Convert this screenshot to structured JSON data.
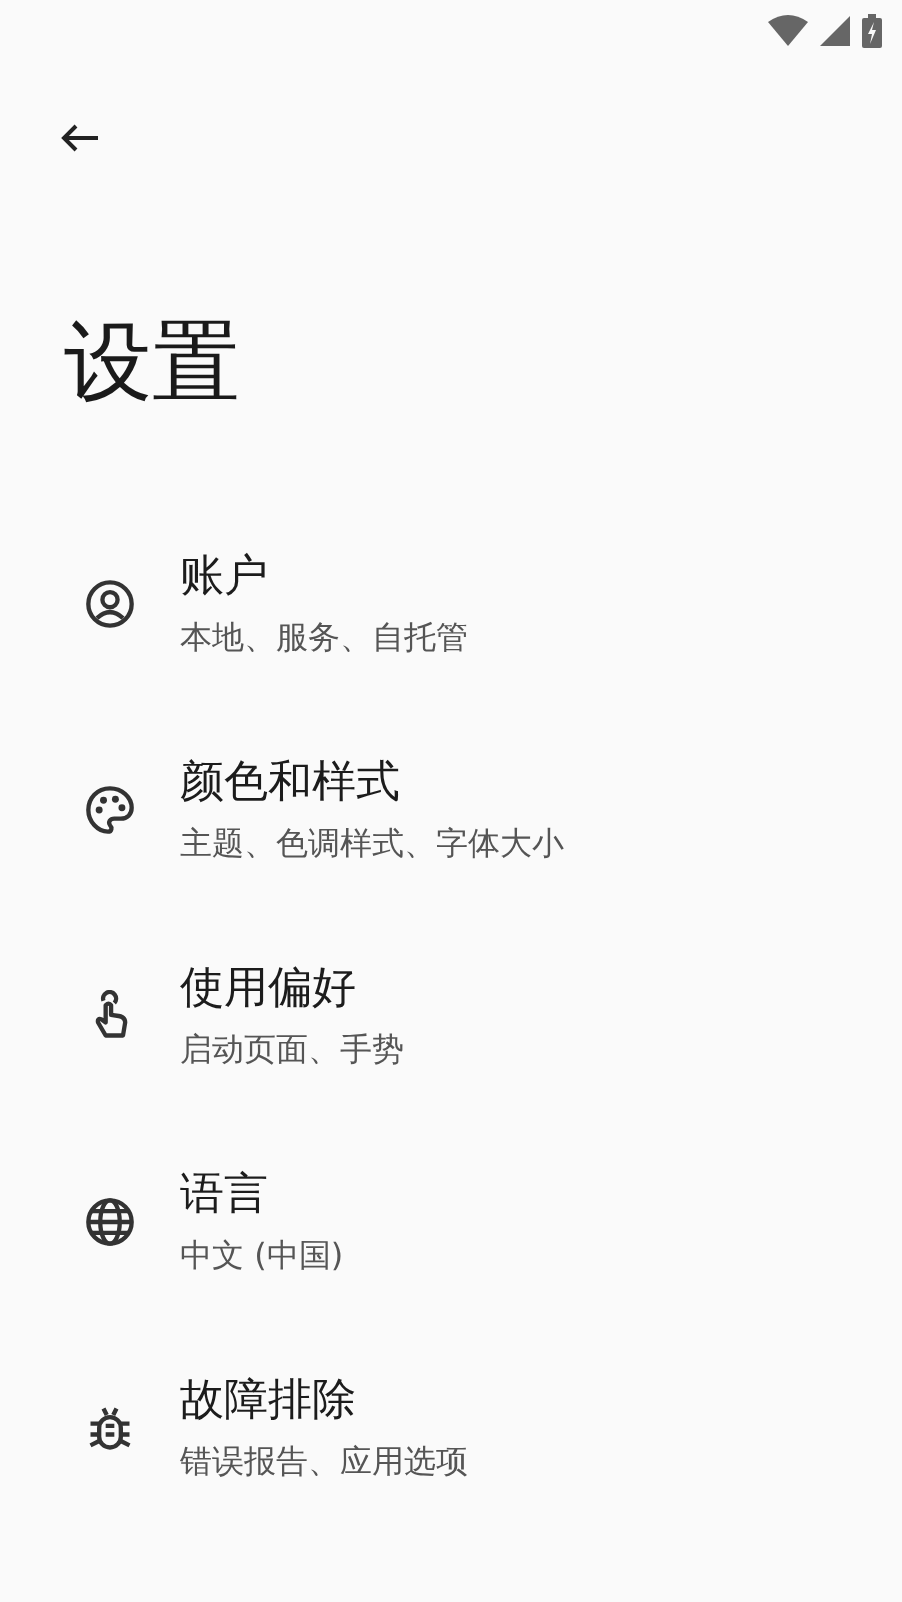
{
  "page_title": "设置",
  "items": [
    {
      "title": "账户",
      "subtitle": "本地、服务、自托管"
    },
    {
      "title": "颜色和样式",
      "subtitle": "主题、色调样式、字体大小"
    },
    {
      "title": "使用偏好",
      "subtitle": "启动页面、手势"
    },
    {
      "title": "语言",
      "subtitle": "中文 (中国)"
    },
    {
      "title": "故障排除",
      "subtitle": "错误报告、应用选项"
    }
  ]
}
